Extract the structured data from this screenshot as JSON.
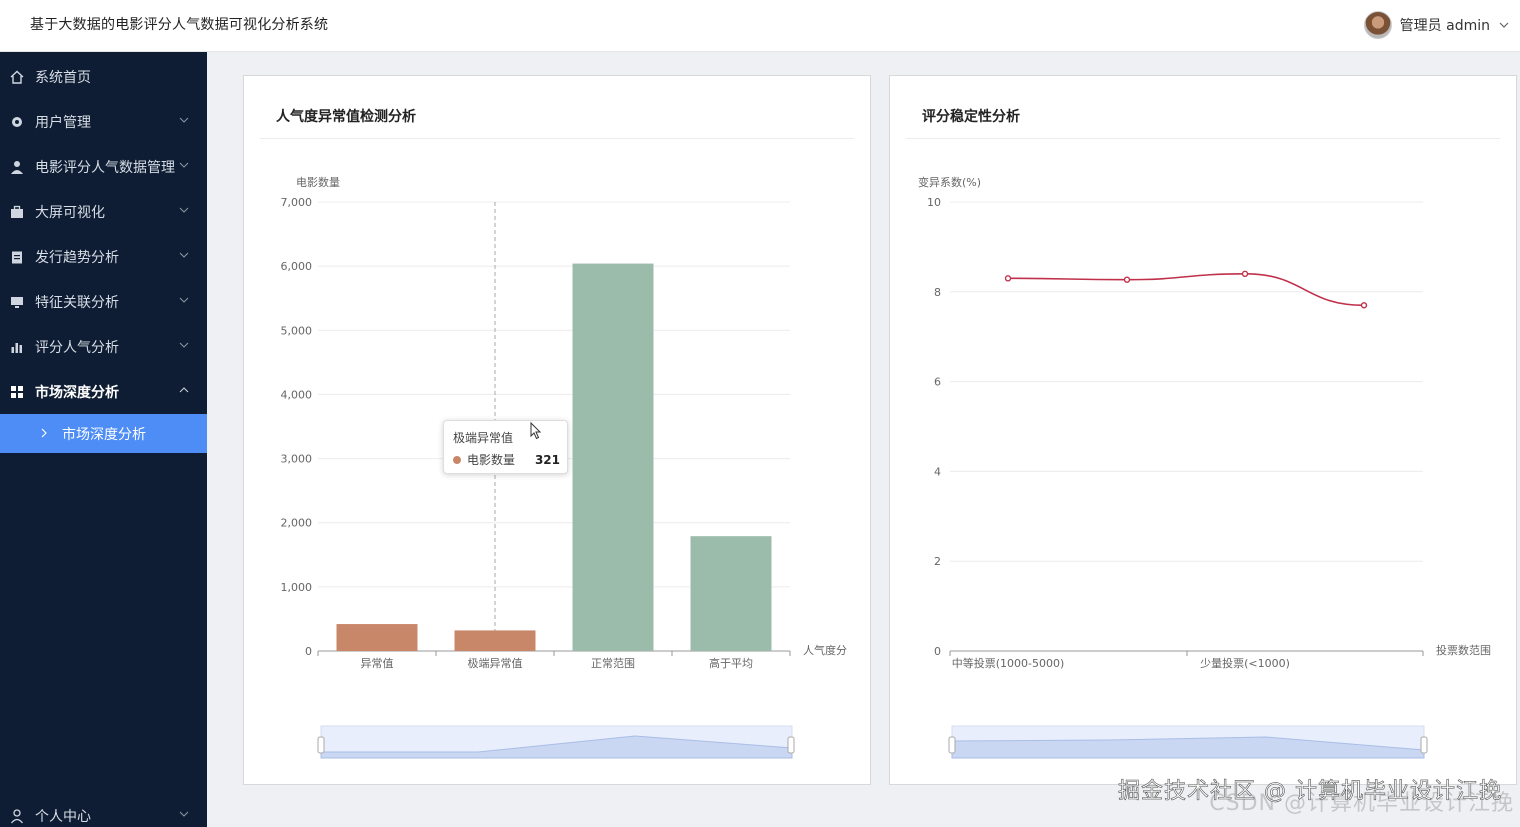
{
  "app": {
    "title": "基于大数据的电影评分人气数据可视化分析系统"
  },
  "user": {
    "name": "管理员 admin"
  },
  "nav": {
    "items": [
      {
        "label": "系统首页",
        "icon": "home-icon",
        "expandable": false
      },
      {
        "label": "用户管理",
        "icon": "gear-icon",
        "expandable": true
      },
      {
        "label": "电影评分人气数据管理",
        "icon": "user-icon",
        "expandable": true
      },
      {
        "label": "大屏可视化",
        "icon": "briefcase-icon",
        "expandable": true
      },
      {
        "label": "发行趋势分析",
        "icon": "clipboard-icon",
        "expandable": true
      },
      {
        "label": "特征关联分析",
        "icon": "monitor-icon",
        "expandable": true
      },
      {
        "label": "评分人气分析",
        "icon": "bar-chart-icon",
        "expandable": true
      },
      {
        "label": "市场深度分析",
        "icon": "grid-icon",
        "expandable": true,
        "open": true
      },
      {
        "label": "个人中心",
        "icon": "person-icon",
        "expandable": true
      }
    ],
    "active_sub": {
      "label": "市场深度分析"
    }
  },
  "panels": {
    "left": {
      "title": "人气度异常值检测分析"
    },
    "right": {
      "title": "评分稳定性分析"
    }
  },
  "tooltip": {
    "title": "极端异常值",
    "series": "电影数量",
    "value": "321"
  },
  "watermark": {
    "primary": "掘金技术社区 @ 计算机毕业设计江挽",
    "secondary": "CSDN @计算机毕业设计江挽"
  },
  "colors": {
    "outlier": "#c9876a",
    "normal": "#9bbcab",
    "line": "#c0304a",
    "sidebar": "#0e1d33",
    "active": "#4d8df5"
  },
  "chart_data": [
    {
      "type": "bar",
      "ylabel": "电影数量",
      "xlabel": "人气度分",
      "categories": [
        "异常值",
        "极端异常值",
        "正常范围",
        "高于平均"
      ],
      "values": [
        420,
        321,
        6040,
        1790
      ],
      "bar_colors": [
        "#c9876a",
        "#c9876a",
        "#9bbcab",
        "#9bbcab"
      ],
      "ylim": [
        0,
        7000
      ],
      "yticks": [
        "0",
        "1,000",
        "2,000",
        "3,000",
        "4,000",
        "5,000",
        "6,000",
        "7,000"
      ],
      "grid": true,
      "datazoom": true
    },
    {
      "type": "line",
      "ylabel": "变异系数(%)",
      "xlabel": "投票数范围",
      "x_labels": [
        "中等投票(1000-5000)",
        "少量投票(<1000)"
      ],
      "values": [
        8.3,
        8.27,
        8.4,
        7.7
      ],
      "ylim": [
        0,
        10
      ],
      "yticks": [
        "0",
        "2",
        "4",
        "6",
        "8",
        "10"
      ],
      "grid": true,
      "datazoom": true
    }
  ]
}
